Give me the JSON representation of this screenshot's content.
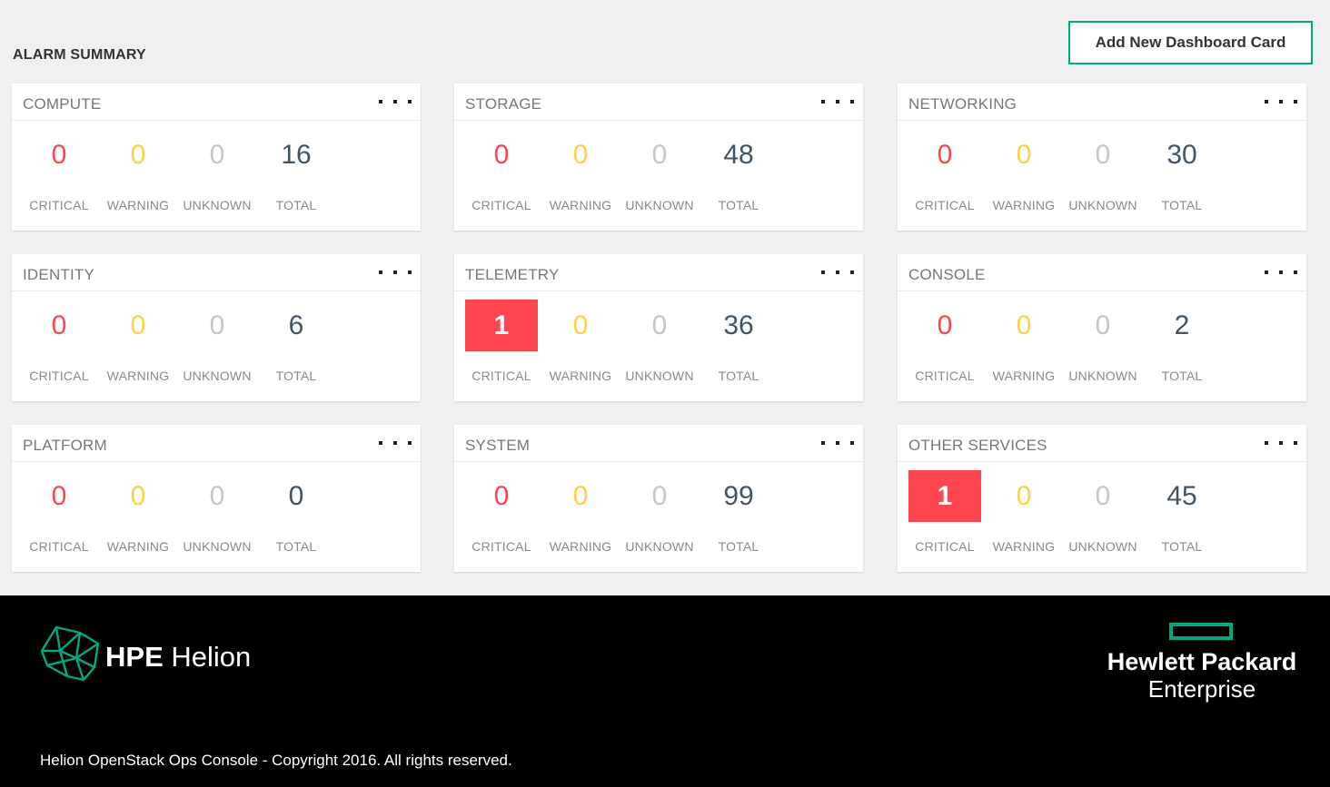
{
  "page": {
    "title": "ALARM SUMMARY",
    "add_button_label": "Add New Dashboard Card"
  },
  "labels": {
    "critical": "CRITICAL",
    "warning": "WARNING",
    "unknown": "UNKNOWN",
    "total": "TOTAL"
  },
  "cards": [
    {
      "title": "COMPUTE",
      "critical": "0",
      "warning": "0",
      "unknown": "0",
      "total": "16"
    },
    {
      "title": "STORAGE",
      "critical": "0",
      "warning": "0",
      "unknown": "0",
      "total": "48"
    },
    {
      "title": "NETWORKING",
      "critical": "0",
      "warning": "0",
      "unknown": "0",
      "total": "30"
    },
    {
      "title": "IDENTITY",
      "critical": "0",
      "warning": "0",
      "unknown": "0",
      "total": "6"
    },
    {
      "title": "TELEMETRY",
      "critical": "1",
      "warning": "0",
      "unknown": "0",
      "total": "36"
    },
    {
      "title": "CONSOLE",
      "critical": "0",
      "warning": "0",
      "unknown": "0",
      "total": "2"
    },
    {
      "title": "PLATFORM",
      "critical": "0",
      "warning": "0",
      "unknown": "0",
      "total": "0"
    },
    {
      "title": "SYSTEM",
      "critical": "0",
      "warning": "0",
      "unknown": "0",
      "total": "99"
    },
    {
      "title": "OTHER SERVICES",
      "critical": "1",
      "warning": "0",
      "unknown": "0",
      "total": "45"
    }
  ],
  "colors": {
    "critical": "#ff454f",
    "warning": "#ffd144",
    "unknown": "#c6c6c6",
    "total": "#425563",
    "accent": "#01a982"
  },
  "icons": {
    "card_menu": "more-horizontal-icon",
    "product_logo": "helion-logo-icon",
    "company_logo": "hpe-element-icon"
  },
  "footer": {
    "product_bold": "HPE",
    "product_name": "Helion",
    "company_line1": "Hewlett Packard",
    "company_line2": "Enterprise",
    "copyright": "Helion OpenStack Ops Console - Copyright 2016. All rights reserved."
  }
}
